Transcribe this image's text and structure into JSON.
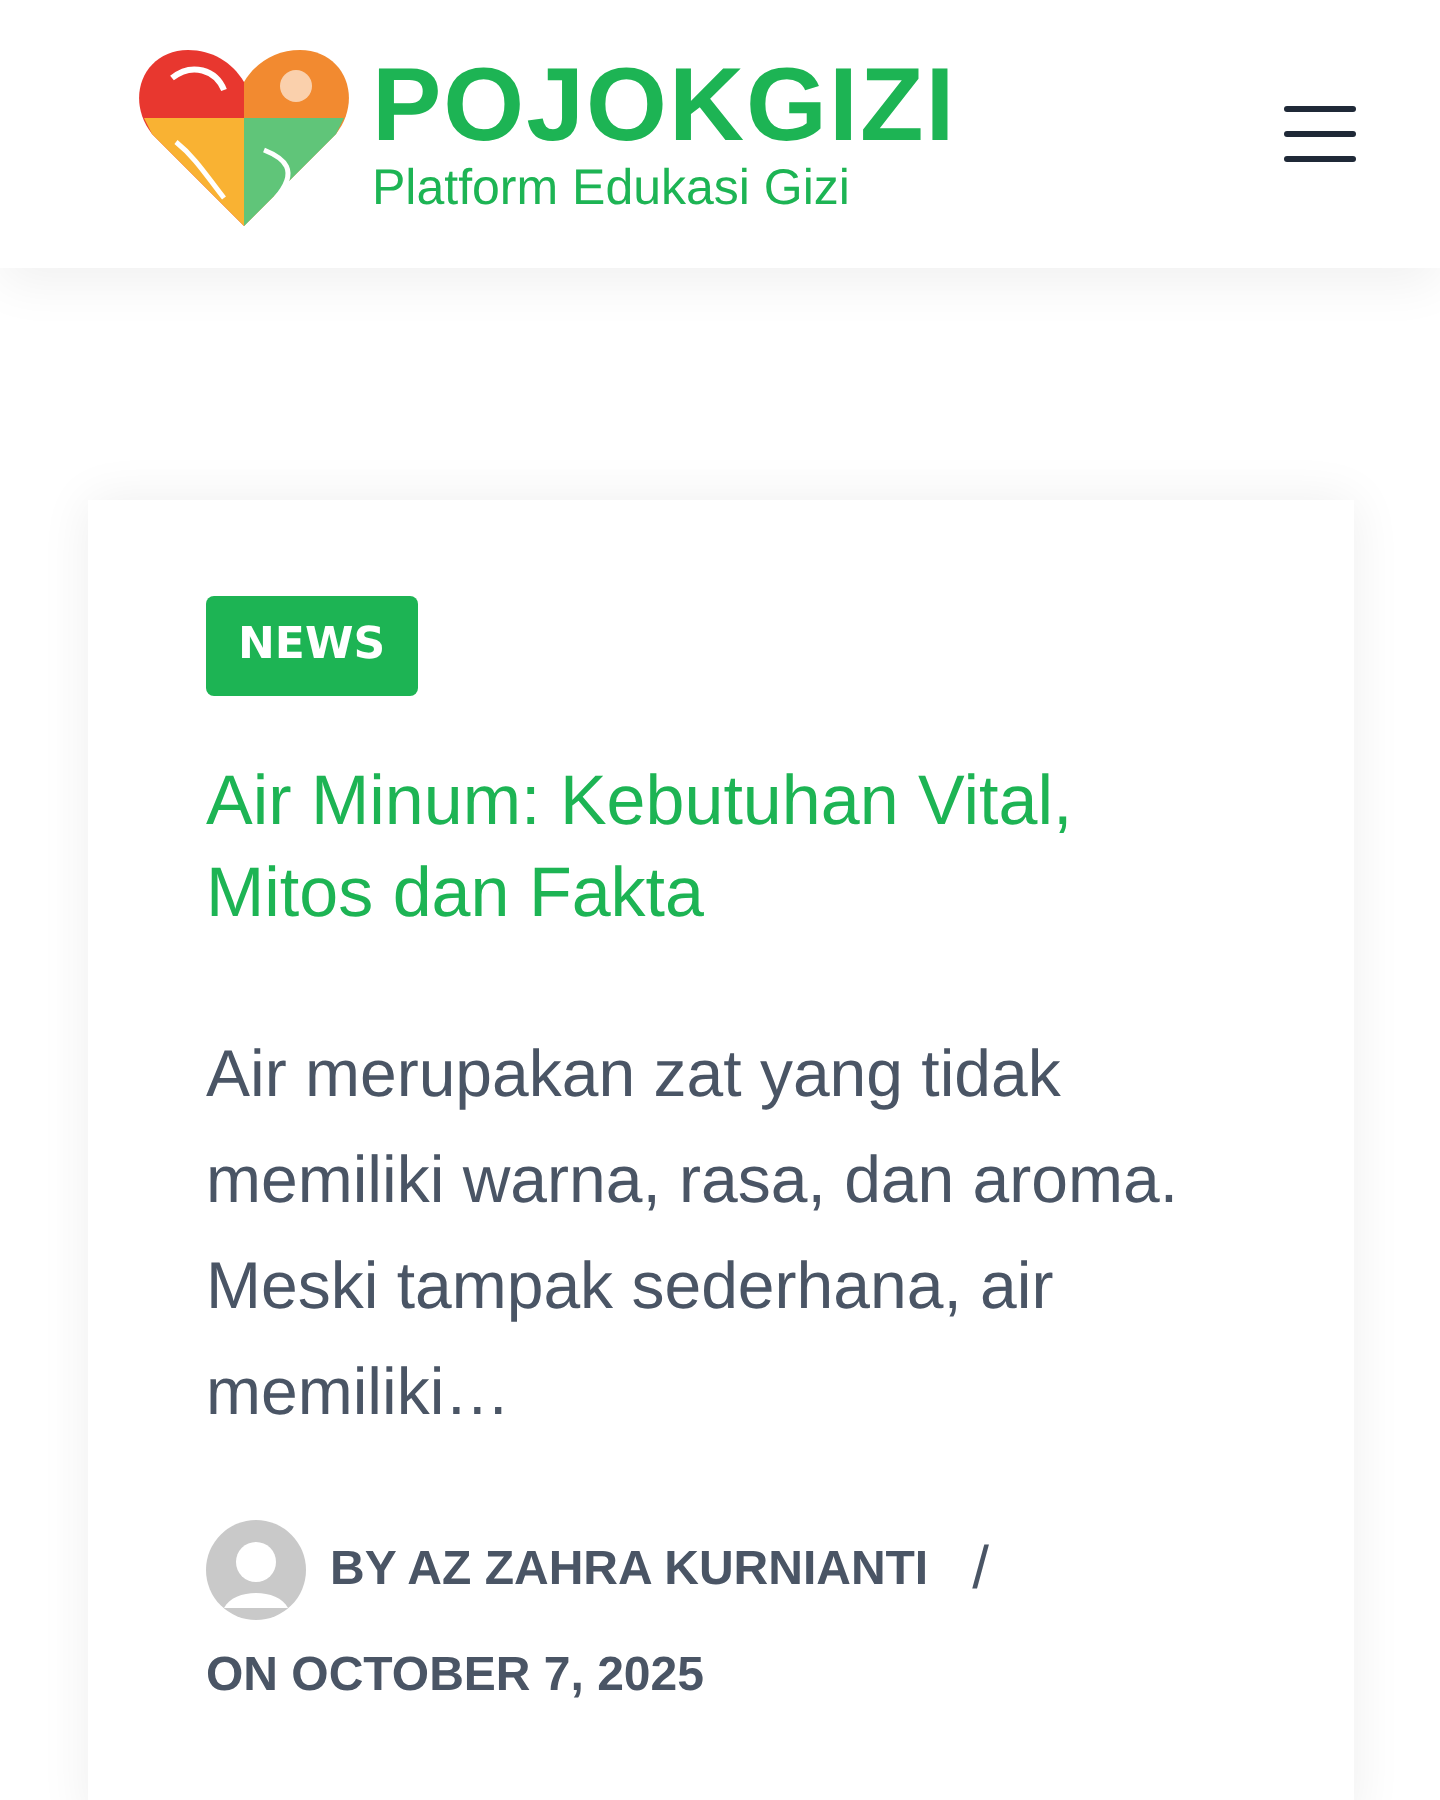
{
  "header": {
    "brand": "POJOKGIZI",
    "tagline": "Platform Edukasi Gizi"
  },
  "post": {
    "category": "NEWS",
    "title": "Air Minum: Kebutuhan Vital, Mitos dan Fakta",
    "excerpt": "Air merupakan zat yang tidak memiliki warna, rasa, dan aroma. Meski tampak sederhana, air memiliki…",
    "author": "BY AZ ZAHRA KURNIANTI",
    "separator": "/",
    "date": "ON OCTOBER 7, 2025"
  }
}
